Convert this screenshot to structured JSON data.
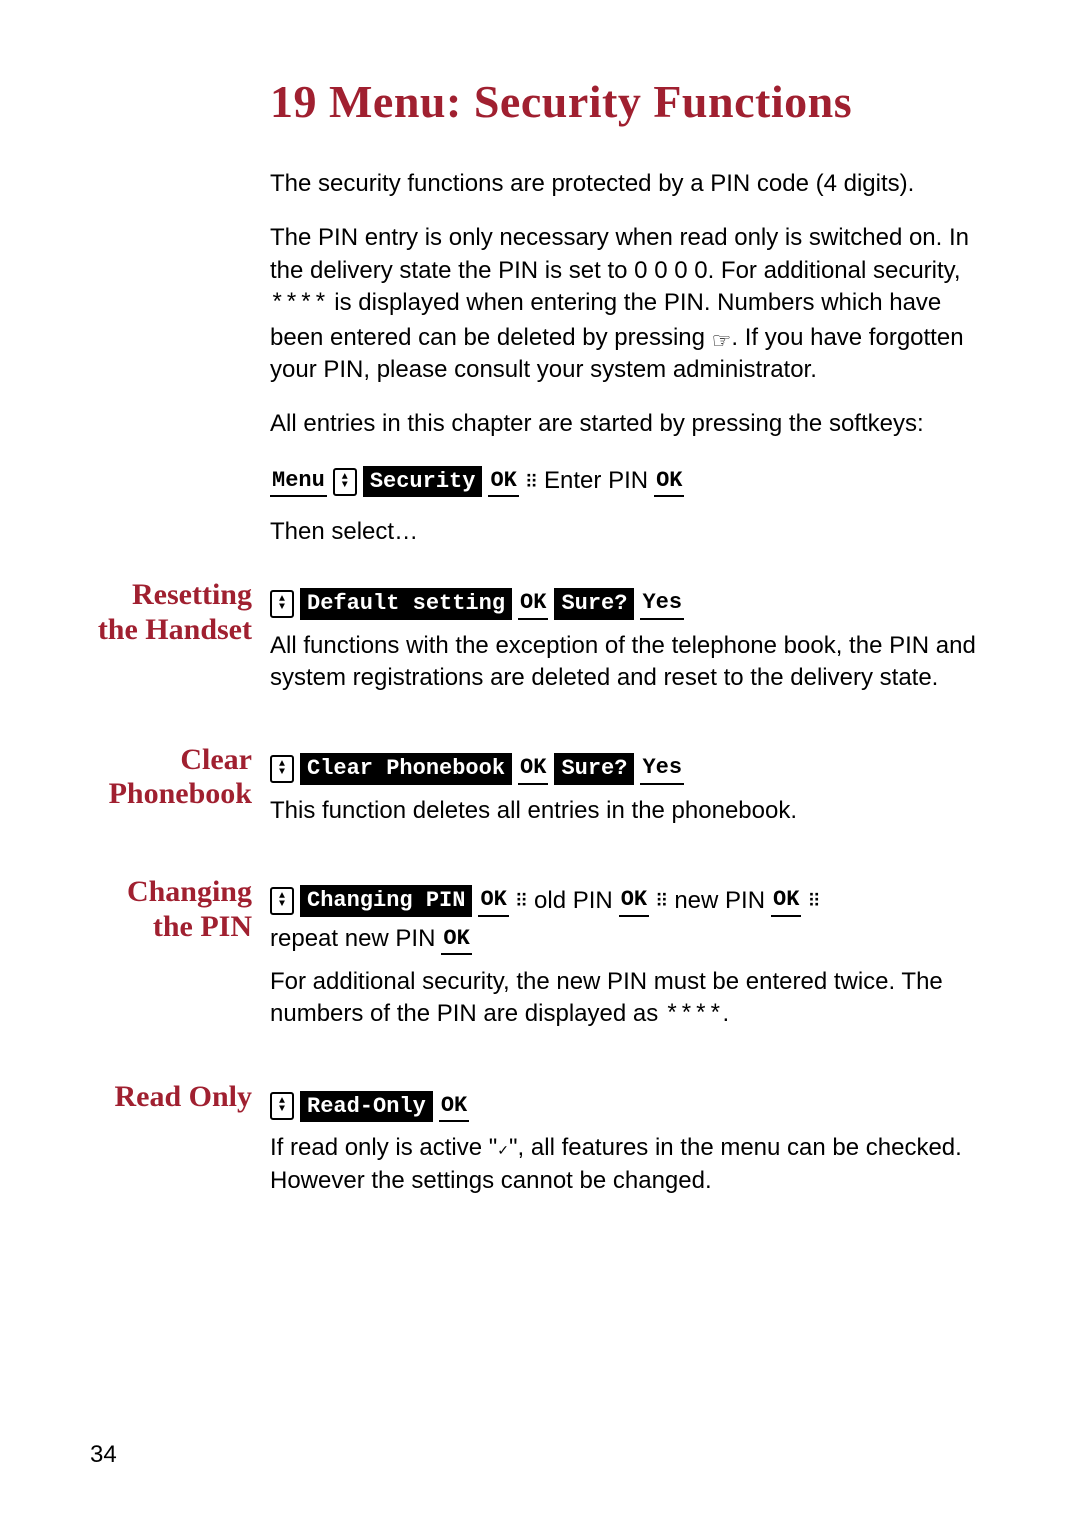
{
  "chapter_number": "19",
  "chapter_title": "Menu: Security Functions",
  "intro": {
    "p1": "The security functions are protected by a PIN code (4 digits).",
    "p2a": "The PIN entry is only necessary when read only is switched on. In the delivery state the PIN is set to 0 0 0 0. For additional security, ",
    "stars": "****",
    "p2b": " is displayed when entering the PIN. Numbers which have been entered can be deleted by pressing ",
    "hook_desc": "hook-icon",
    "p2c": ". If you have forgotten your PIN, please consult your system administrator.",
    "p3": "All entries in this chapter are started by pressing the softkeys:",
    "seq": {
      "menu": "Menu",
      "security": "Security",
      "ok1": "OK",
      "enter_pin": "Enter PIN",
      "ok2": "OK"
    },
    "then": "Then select…"
  },
  "sections": {
    "reset": {
      "heading": "Resetting the Handset",
      "seq": {
        "default": "Default setting",
        "ok": "OK",
        "sure": "Sure?",
        "yes": "Yes"
      },
      "body": "All functions with the exception of the telephone book, the PIN and system registrations are deleted and reset to the delivery state."
    },
    "clear": {
      "heading": "Clear Phonebook",
      "seq": {
        "clear": "Clear Phonebook",
        "ok": "OK",
        "sure": "Sure?",
        "yes": "Yes"
      },
      "body": "This function deletes all entries in the phonebook."
    },
    "pin": {
      "heading": "Changing the PIN",
      "seq": {
        "changing": "Changing PIN",
        "ok1": "OK",
        "old": "old PIN",
        "ok2": "OK",
        "new": "new PIN",
        "ok3": "OK",
        "repeat": "repeat new PIN",
        "ok4": "OK"
      },
      "body_a": "For additional security, the new PIN must be entered twice. The numbers of the PIN are displayed as ",
      "stars": "****",
      "body_b": "."
    },
    "readonly": {
      "heading": "Read Only",
      "seq": {
        "read": "Read-Only",
        "ok": "OK"
      },
      "body_a": "If read only is active \"",
      "tick": "✓",
      "body_b": "\", all features in the menu can be checked. However the settings cannot be changed."
    }
  },
  "page_number": "34"
}
